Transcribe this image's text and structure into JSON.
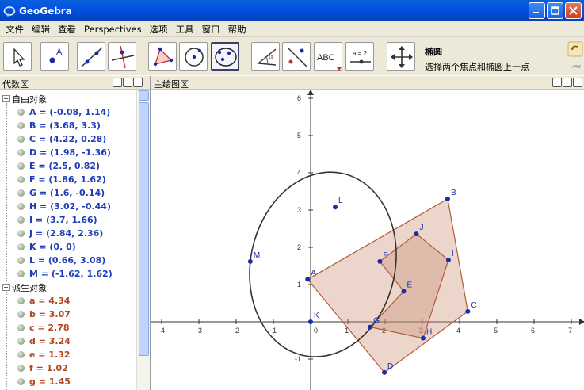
{
  "window": {
    "title": "GeoGebra",
    "buttons": [
      "minimize",
      "maximize",
      "close"
    ]
  },
  "menu": [
    "文件",
    "编辑",
    "查看",
    "Perspectives",
    "选项",
    "工具",
    "窗口",
    "帮助"
  ],
  "toolbar": {
    "tools": [
      {
        "icon": "move-arrow-icon"
      },
      {
        "icon": "new-point-icon",
        "label": "A"
      },
      {
        "icon": "line-through-two-points-icon"
      },
      {
        "icon": "perpendicular-line-icon"
      },
      {
        "icon": "polygon-icon"
      },
      {
        "icon": "circle-center-point-icon"
      },
      {
        "icon": "ellipse-icon"
      },
      {
        "icon": "angle-icon",
        "label": "α"
      },
      {
        "icon": "reflect-about-line-icon"
      },
      {
        "icon": "insert-text-icon",
        "label": "ABC"
      },
      {
        "icon": "slider-icon",
        "label": "a = 2"
      },
      {
        "icon": "move-graphics-view-icon"
      }
    ],
    "selected_index": 6,
    "selected_tool_name": "椭圆",
    "selected_tool_help": "选择两个焦点和椭圆上一点"
  },
  "algebra": {
    "header": "代数区",
    "free_group": "自由对象",
    "free_items": [
      "A = (-0.08, 1.14)",
      "B = (3.68, 3.3)",
      "C = (4.22, 0.28)",
      "D = (1.98, -1.36)",
      "E = (2.5, 0.82)",
      "F = (1.86, 1.62)",
      "G = (1.6, -0.14)",
      "H = (3.02, -0.44)",
      "I = (3.7, 1.66)",
      "J = (2.84, 2.36)",
      "K = (0, 0)",
      "L = (0.66, 3.08)",
      "M = (-1.62, 1.62)"
    ],
    "derived_group": "派生对象",
    "derived_items": [
      "a = 4.34",
      "b = 3.07",
      "c = 2.78",
      "d = 3.24",
      "e = 1.32",
      "f = 1.02",
      "g = 1.45"
    ]
  },
  "graphics": {
    "header": "主绘图区",
    "x_ticks": [
      "-4",
      "-3",
      "-2",
      "-1",
      "0",
      "1",
      "2",
      "3",
      "4",
      "5",
      "6",
      "7"
    ],
    "y_ticks": [
      "6",
      "5",
      "4",
      "3",
      "2",
      "1",
      "-1"
    ],
    "points": [
      {
        "name": "A",
        "x": -0.08,
        "y": 1.14
      },
      {
        "name": "B",
        "x": 3.68,
        "y": 3.3
      },
      {
        "name": "C",
        "x": 4.22,
        "y": 0.28
      },
      {
        "name": "D",
        "x": 1.98,
        "y": -1.36
      },
      {
        "name": "E",
        "x": 2.5,
        "y": 0.82
      },
      {
        "name": "F",
        "x": 1.86,
        "y": 1.62
      },
      {
        "name": "G",
        "x": 1.6,
        "y": -0.14
      },
      {
        "name": "H",
        "x": 3.02,
        "y": -0.44
      },
      {
        "name": "I",
        "x": 3.7,
        "y": 1.66
      },
      {
        "name": "J",
        "x": 2.84,
        "y": 2.36
      },
      {
        "name": "K",
        "x": 0,
        "y": 0
      },
      {
        "name": "L",
        "x": 0.66,
        "y": 3.08
      },
      {
        "name": "M",
        "x": -1.62,
        "y": 1.62
      }
    ],
    "outer_polygon": [
      "A",
      "B",
      "C",
      "D"
    ],
    "inner_polygon": [
      "F",
      "J",
      "I",
      "H",
      "G",
      "E"
    ],
    "ellipse": {
      "foci": [
        "K",
        "L"
      ],
      "through": "M"
    },
    "colors": {
      "point": "#1a2aa8",
      "polygon_stroke": "#b35a3a",
      "polygon_fill": "#c98a6e",
      "ellipse": "#333333",
      "axis": "#333333"
    }
  }
}
